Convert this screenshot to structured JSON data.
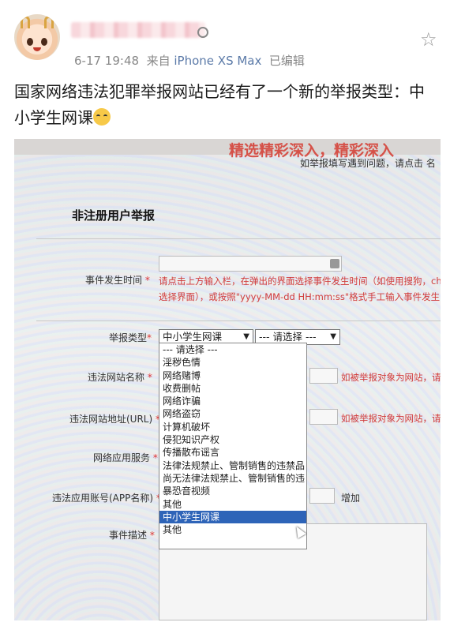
{
  "post": {
    "time": "6-17 19:48",
    "source_prefix": "来自",
    "device": "iPhone XS Max",
    "edited": "已编辑",
    "text": "国家网络违法犯罪举报网站已经有了一个新的举报类型：中小学生网课"
  },
  "photo": {
    "banner": "精选精彩深入，精彩深入",
    "help_text": "如举报填写遇到问题，请点击 名",
    "form_title": "非注册用户举报",
    "fields": {
      "event_time_label": "事件发生时间",
      "event_time_note1": "请点击上方输入栏，在弹出的界面选择事件发生时间（如使用搜狗，chrome",
      "event_time_note2": "选择界面），或按照\"yyyy-MM-dd HH:mm:ss\"格式手工输入事件发生时间,如",
      "report_type_label": "举报类型",
      "report_type_selected": "中小学生网课",
      "second_select": "--- 请选择 ---",
      "site_name_label": "违法网站名称",
      "site_note": "如被举报对象为网站，请填",
      "site_url_label": "违法网站地址(URL)",
      "url_note": "如被举报对象为网站，请填",
      "app_service_label": "网络应用服务",
      "app_account_label": "违法应用账号(APP名称)",
      "add_button": "增加",
      "description_label": "事件描述"
    },
    "dropdown_options": [
      "--- 请选择 ---",
      "淫秽色情",
      "网络赌博",
      "收费删帖",
      "网络诈骗",
      "网络盗窃",
      "计算机破坏",
      "侵犯知识产权",
      "传播散布谣言",
      "法律法规禁止、管制销售的违禁品",
      "尚无法律法规禁止、管制销售的违",
      "暴恐音视频",
      "其他",
      "中小学生网课",
      "其他"
    ],
    "selected_index": 13,
    "required_mark": "*"
  }
}
